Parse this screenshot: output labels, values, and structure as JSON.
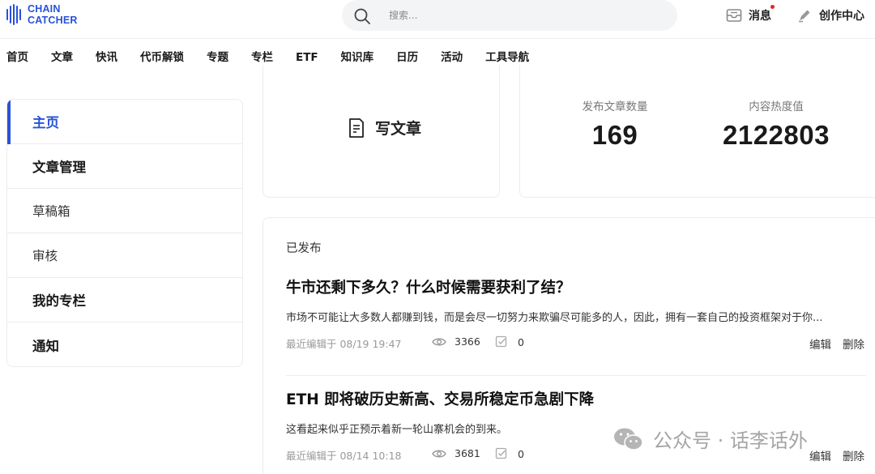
{
  "brand": {
    "line1": "CHAIN",
    "line2": "CATCHER",
    "color": "#2752d8"
  },
  "header": {
    "search_placeholder": "搜索...",
    "messages_label": "消息",
    "creator_center_label": "创作中心"
  },
  "nav": {
    "items": [
      "首页",
      "文章",
      "快讯",
      "代币解锁",
      "专题",
      "专栏",
      "ETF",
      "知识库",
      "日历",
      "活动",
      "工具导航"
    ]
  },
  "sidebar": {
    "items": [
      {
        "label": "主页",
        "active": true
      },
      {
        "label": "文章管理"
      },
      {
        "label": "草稿箱"
      },
      {
        "label": "审核"
      },
      {
        "label": "我的专栏"
      },
      {
        "label": "通知"
      }
    ]
  },
  "write": {
    "label": "写文章"
  },
  "stats": {
    "articles_label": "发布文章数量",
    "articles_value": "169",
    "heat_label": "内容热度值",
    "heat_value": "2122803"
  },
  "published": {
    "heading": "已发布",
    "edit_label": "编辑",
    "delete_label": "删除",
    "articles": [
      {
        "title": "牛市还剩下多久？什么时候需要获利了结？",
        "summary": "市场不可能让大多数人都赚到钱，而是会尽一切努力来欺骗尽可能多的人，因此，拥有一套自己的投资框架对于你...",
        "edited": "最近编辑于 08/19 19:47",
        "views": "3366",
        "comments": "0"
      },
      {
        "title": "ETH 即将破历史新高、交易所稳定币急剧下降",
        "summary": "这看起来似乎正预示着新一轮山寨机会的到来。",
        "edited": "最近编辑于 08/14 10:18",
        "views": "3681",
        "comments": "0"
      }
    ]
  },
  "watermark": {
    "text": "公众号 · 话李话外"
  },
  "colors": {
    "accent": "#2752d8",
    "notification_dot": "#e32626"
  }
}
